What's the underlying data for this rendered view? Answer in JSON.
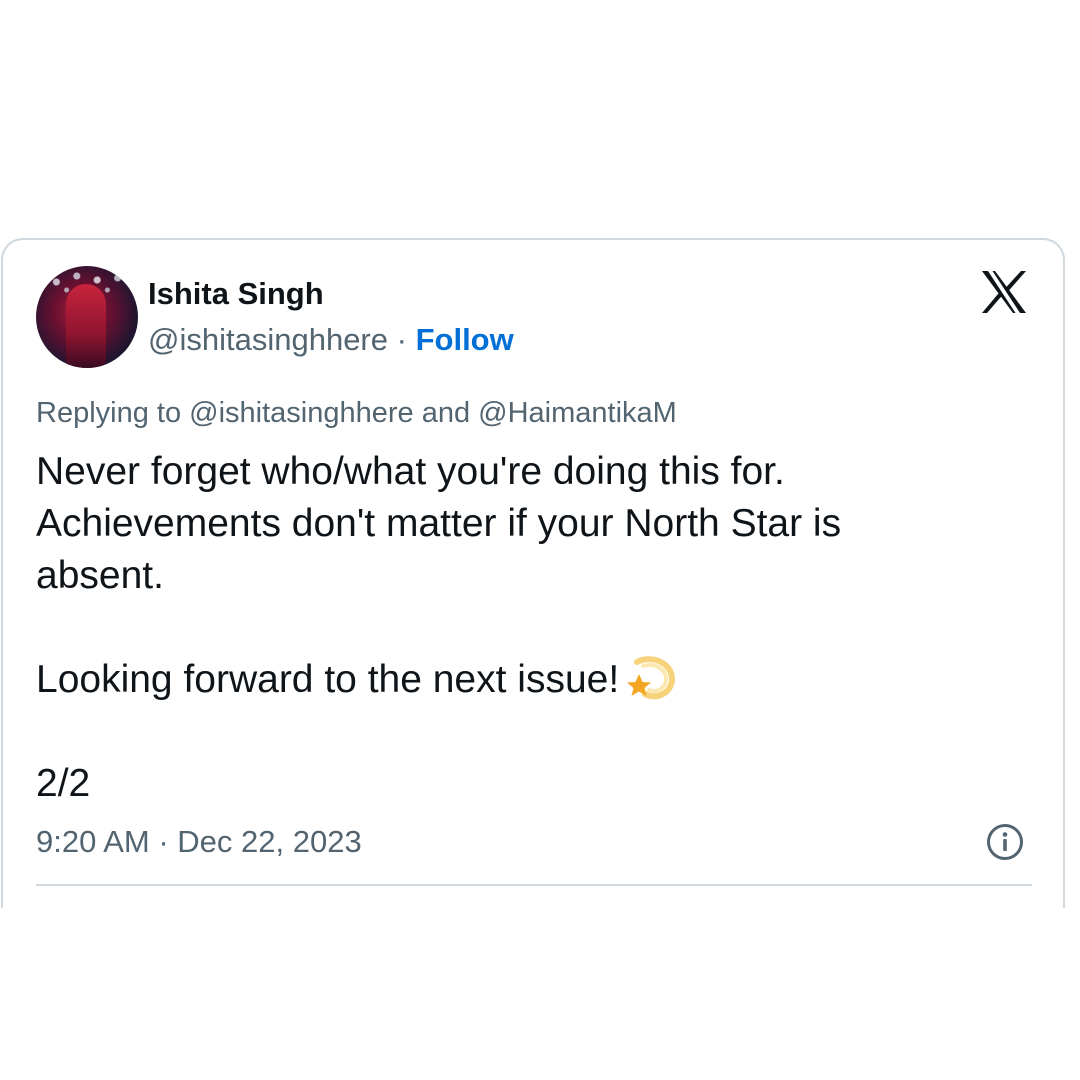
{
  "tweet": {
    "author": {
      "display_name": "Ishita Singh",
      "handle": "@ishitasinghhere",
      "separator": "·",
      "follow_label": "Follow"
    },
    "reply_context": "Replying to @ishitasinghhere and @HaimantikaM",
    "body": {
      "line1": "Never forget who/what you're doing this for.",
      "line2": "Achievements don't matter if your North Star is",
      "line3": "absent.",
      "line4": "Looking forward to the next issue!",
      "line5": "2/2"
    },
    "emoji": "shooting-star-emoji",
    "timestamp": "9:20 AM · Dec 22, 2023"
  },
  "icons": {
    "logo": "x-logo-icon",
    "info": "info-icon"
  },
  "colors": {
    "text_primary": "#0f1419",
    "text_secondary": "#536471",
    "link": "#006fd6",
    "border": "#cfd9de"
  }
}
